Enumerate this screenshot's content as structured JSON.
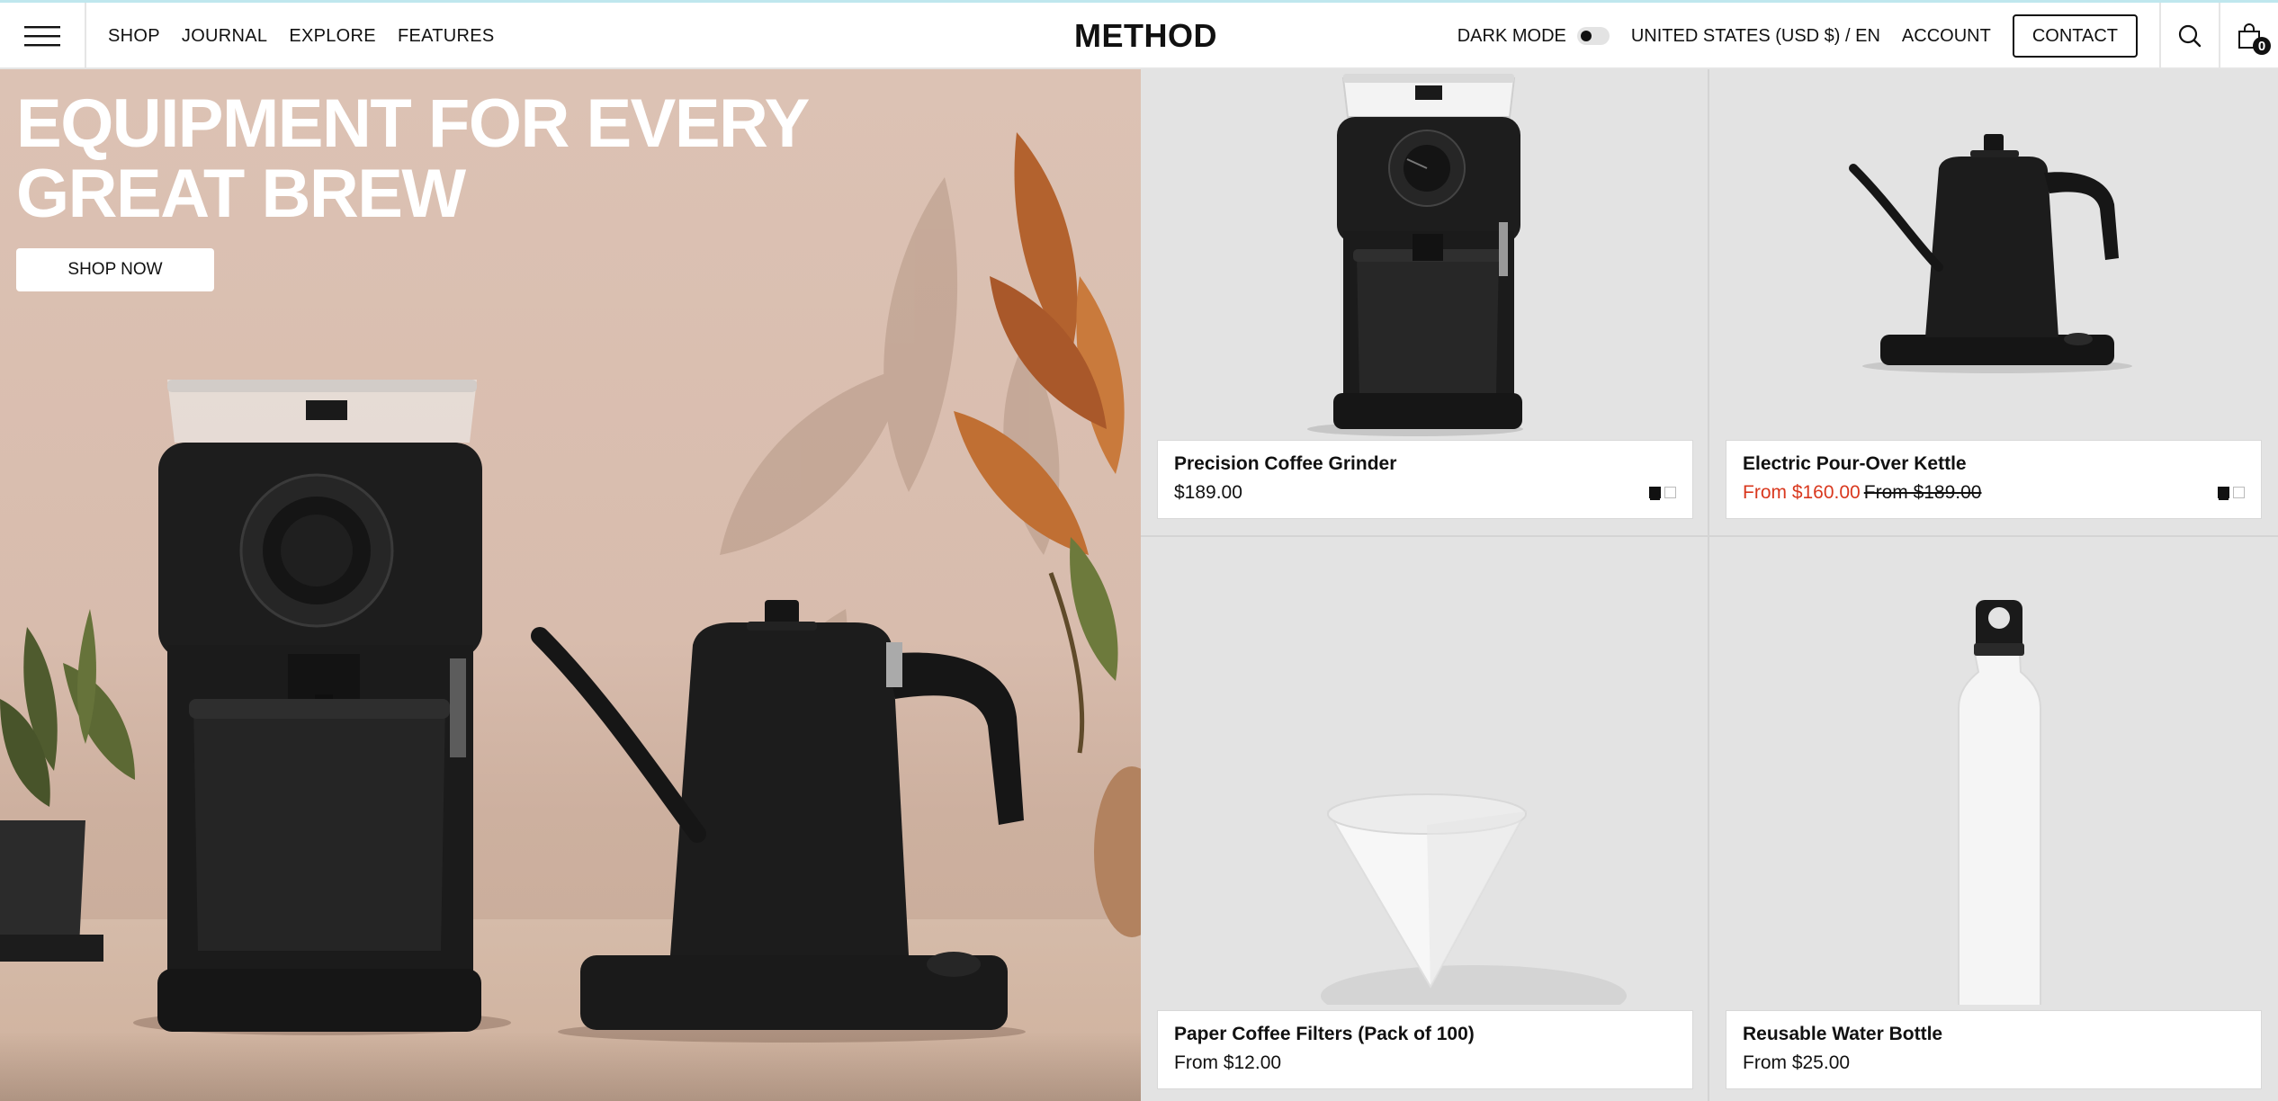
{
  "header": {
    "nav": [
      "SHOP",
      "JOURNAL",
      "EXPLORE",
      "FEATURES"
    ],
    "logo": "METHOD",
    "dark_mode_label": "DARK MODE",
    "locale": "UNITED STATES (USD $) / EN",
    "account": "ACCOUNT",
    "contact": "CONTACT",
    "cart_count": "0",
    "icons": [
      "hamburger-menu-icon",
      "search-icon",
      "cart-icon"
    ]
  },
  "hero": {
    "title": "EQUIPMENT FOR EVERY GREAT BREW",
    "cta": "SHOP NOW"
  },
  "products": [
    {
      "name": "Precision Coffee Grinder",
      "price": "$189.00",
      "swatches": [
        "black",
        "white"
      ]
    },
    {
      "name": "Electric Pour-Over Kettle",
      "sale_price": "From $160.00",
      "compare_price": "From $189.00",
      "swatches": [
        "black",
        "white"
      ]
    },
    {
      "name": "Paper Coffee Filters (Pack of 100)",
      "price": "From $12.00"
    },
    {
      "name": "Reusable Water Bottle",
      "price": "From $25.00"
    }
  ],
  "colors": {
    "sale": "#d9381e",
    "hero_bg": "#dcc2b4",
    "grid_bg": "#e3e3e3"
  }
}
